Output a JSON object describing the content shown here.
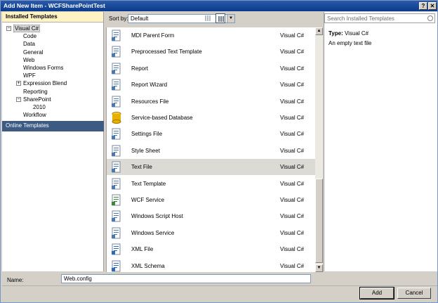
{
  "window": {
    "title": "Add New Item - WCFSharePointTest",
    "help_glyph": "?",
    "close_glyph": "✕"
  },
  "left_pane": {
    "header": "Installed Templates",
    "tree": [
      {
        "label": "Visual C#",
        "level": 0,
        "expander": "−",
        "selected": true
      },
      {
        "label": "Code",
        "level": 1,
        "expander": ""
      },
      {
        "label": "Data",
        "level": 1,
        "expander": ""
      },
      {
        "label": "General",
        "level": 1,
        "expander": ""
      },
      {
        "label": "Web",
        "level": 1,
        "expander": ""
      },
      {
        "label": "Windows Forms",
        "level": 1,
        "expander": ""
      },
      {
        "label": "WPF",
        "level": 1,
        "expander": ""
      },
      {
        "label": "Expression Blend",
        "level": 1,
        "expander": "+"
      },
      {
        "label": "Reporting",
        "level": 1,
        "expander": ""
      },
      {
        "label": "SharePoint",
        "level": 1,
        "expander": "−"
      },
      {
        "label": "2010",
        "level": 2,
        "expander": ""
      },
      {
        "label": "Workflow",
        "level": 1,
        "expander": ""
      }
    ],
    "online": "Online Templates"
  },
  "toolbar": {
    "sort_label": "Sort by:",
    "sort_value": "Default"
  },
  "items": [
    {
      "name": "MDI Parent Form",
      "lang": "Visual C#",
      "icon": "form-icon"
    },
    {
      "name": "Preprocessed Text Template",
      "lang": "Visual C#",
      "icon": "template-icon"
    },
    {
      "name": "Report",
      "lang": "Visual C#",
      "icon": "report-icon"
    },
    {
      "name": "Report Wizard",
      "lang": "Visual C#",
      "icon": "report-wizard-icon"
    },
    {
      "name": "Resources File",
      "lang": "Visual C#",
      "icon": "resources-icon"
    },
    {
      "name": "Service-based Database",
      "lang": "Visual C#",
      "icon": "database-icon"
    },
    {
      "name": "Settings File",
      "lang": "Visual C#",
      "icon": "settings-file-icon"
    },
    {
      "name": "Style Sheet",
      "lang": "Visual C#",
      "icon": "stylesheet-icon"
    },
    {
      "name": "Text File",
      "lang": "Visual C#",
      "icon": "text-file-icon",
      "selected": true
    },
    {
      "name": "Text Template",
      "lang": "Visual C#",
      "icon": "text-template-icon"
    },
    {
      "name": "WCF Service",
      "lang": "Visual C#",
      "icon": "wcf-service-icon"
    },
    {
      "name": "Windows Script Host",
      "lang": "Visual C#",
      "icon": "script-host-icon"
    },
    {
      "name": "Windows Service",
      "lang": "Visual C#",
      "icon": "windows-service-icon"
    },
    {
      "name": "XML File",
      "lang": "Visual C#",
      "icon": "xml-file-icon"
    },
    {
      "name": "XML Schema",
      "lang": "Visual C#",
      "icon": "xml-schema-icon"
    }
  ],
  "right_pane": {
    "search_placeholder": "Search Installed Templates",
    "type_label": "Type:",
    "type_value": "Visual C#",
    "description": "An empty text file"
  },
  "bottom": {
    "name_label": "Name:",
    "name_value": "Web.config",
    "add_label": "Add",
    "cancel_label": "Cancel"
  },
  "colors": {
    "title_bar": "#0a3a8c",
    "header_bg": "#fff3c4",
    "online_bg": "#3c5a82",
    "selected_row": "#dcdad5"
  }
}
